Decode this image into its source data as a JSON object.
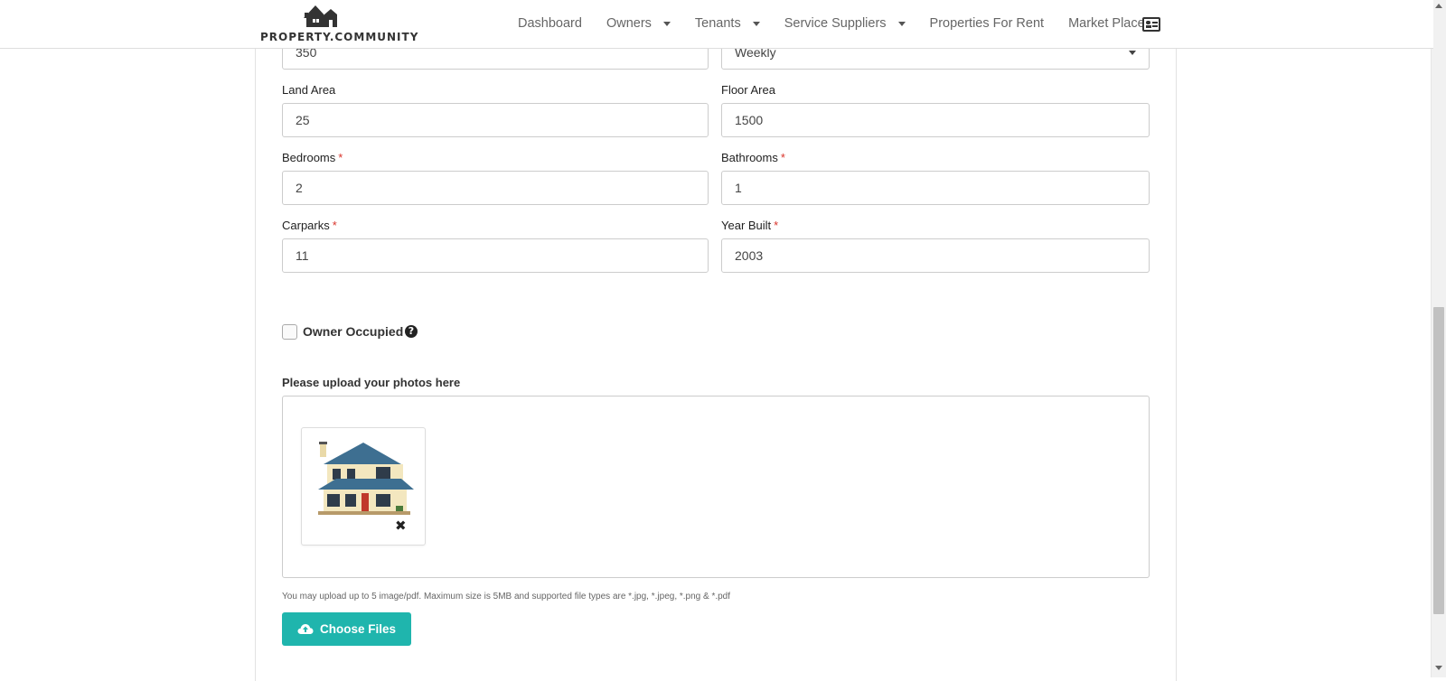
{
  "header": {
    "logo_text": "PROPERTY.COMMUNITY",
    "nav": [
      {
        "label": "Dashboard"
      },
      {
        "label": "Owners"
      },
      {
        "label": "Tenants"
      },
      {
        "label": "Service Suppliers"
      },
      {
        "label": "Properties For Rent"
      },
      {
        "label": "Market Place"
      }
    ],
    "profile_icon": "contact-card-icon"
  },
  "form": {
    "rent_value": "350",
    "rent_frequency": "Weekly",
    "land_area": {
      "label": "Land Area",
      "value": "25"
    },
    "floor_area": {
      "label": "Floor Area",
      "value": "1500"
    },
    "bedrooms": {
      "label": "Bedrooms",
      "value": "2"
    },
    "bathrooms": {
      "label": "Bathrooms",
      "value": "1"
    },
    "carparks": {
      "label": "Carparks",
      "value": "11"
    },
    "year_built": {
      "label": "Year Built",
      "value": "2003"
    },
    "required_mark": "*",
    "owner_occupied": {
      "label": "Owner Occupied",
      "checked": false,
      "help_icon": "question-circle-icon"
    },
    "upload": {
      "label": "Please upload your photos here",
      "note": "You may upload up to 5 image/pdf. Maximum size is 5MB and supported file types are *.jpg, *.jpeg, *.png & *.pdf",
      "button_label": "Choose Files",
      "button_icon": "cloud-upload-icon",
      "remove_icon": "close-icon",
      "remove_glyph": "✖"
    }
  },
  "colors": {
    "accent": "#1fb5ad",
    "required": "#d9342b"
  }
}
